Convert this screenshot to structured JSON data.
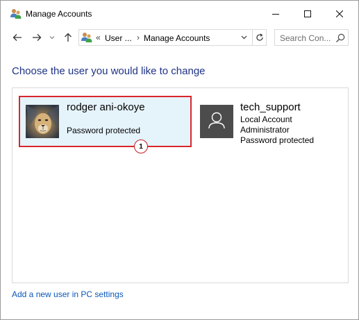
{
  "window": {
    "title": "Manage Accounts"
  },
  "nav": {
    "breadcrumb_prefix": "«",
    "breadcrumb_parent": "User ...",
    "breadcrumb_separator": "›",
    "breadcrumb_current": "Manage Accounts",
    "search_placeholder": "Search Con..."
  },
  "content": {
    "heading": "Choose the user you would like to change",
    "accounts": [
      {
        "name": "rodger ani-okoye",
        "details": [
          "Password protected"
        ],
        "selected": true,
        "avatar": "lion-photo"
      },
      {
        "name": "tech_support",
        "details": [
          "Local Account",
          "Administrator",
          "Password protected"
        ],
        "selected": false,
        "avatar": "generic-user-icon"
      }
    ],
    "step_marker": "1",
    "add_user_link": "Add a new user in PC settings"
  },
  "colors": {
    "heading": "#1e3287",
    "link": "#0b57b8",
    "selection_fill": "#e5f3fb",
    "highlight_border": "#d9262b",
    "avatar_generic_bg": "#4c4c4c"
  }
}
